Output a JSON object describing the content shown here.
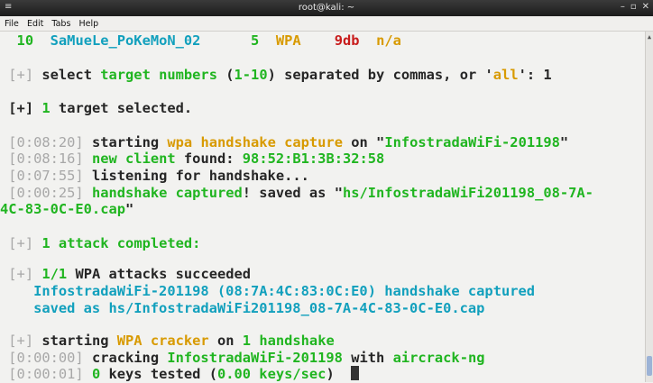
{
  "window": {
    "title": "root@kali: ~",
    "menu_glyph": "≡",
    "controls": [
      "–",
      "▫",
      "✕"
    ]
  },
  "menubar": {
    "items": [
      "File",
      "Edit",
      "Tabs",
      "Help"
    ]
  },
  "terminal": {
    "row10": {
      "num": "10",
      "essid": "SaMueLe_PoKeMoN_02",
      "channel": "5",
      "enc": "WPA",
      "power": "9db",
      "wps": "n/a"
    },
    "select": {
      "tag": "[+]",
      "p1": " select ",
      "p2": "target numbers",
      "p3": " (",
      "p4": "1-10",
      "p5": ") separated by commas, or '",
      "p6": "all",
      "p7": "': 1"
    },
    "selected": {
      "tag": "[+]",
      "num": "1",
      "text": " target selected."
    },
    "capture": [
      {
        "time": "[0:08:20]",
        "a": "starting ",
        "b": "wpa handshake capture",
        "c": " on \"",
        "d": "InfostradaWiFi-201198",
        "e": "\""
      },
      {
        "time": "[0:08:16]",
        "a": "new client",
        "b": " found: ",
        "c": "98:52:B1:3B:32:58"
      },
      {
        "time": "[0:07:55]",
        "a": "listening for handshake..."
      },
      {
        "time": "[0:00:25]",
        "a": "handshake captured",
        "b": "! saved as \"",
        "c": "hs/InfostradaWiFi201198_08-7A-",
        "d": "4C-83-0C-E0.cap",
        "e": "\""
      }
    ],
    "attack": {
      "tag": "[+]",
      "num": "1",
      "text": " attack completed:"
    },
    "result": {
      "tag": "[+]",
      "ratio": "1/1",
      "text": " WPA attacks succeeded",
      "l2": "    InfostradaWiFi-201198 (08:7A:4C:83:0C:E0) handshake captured",
      "l3": "    saved as hs/InfostradaWiFi201198_08-7A-4C-83-0C-E0.cap"
    },
    "cracker": {
      "tag": "[+]",
      "a": " starting ",
      "b": "WPA cracker",
      "c": " on ",
      "d": "1",
      "e": " handshake"
    },
    "crack_lines": [
      {
        "time": "[0:00:00]",
        "a": " cracking ",
        "b": "InfostradaWiFi-201198",
        "c": " with ",
        "d": "aircrack-ng"
      },
      {
        "time": "[0:00:01]",
        "a": " 0",
        "b": " keys tested (",
        "c": "0.00 keys/sec",
        "d": ")"
      }
    ]
  },
  "colors": {
    "background": "#f2f2f0",
    "green": "#20b520",
    "yellow": "#d89a00",
    "red": "#c81c1c",
    "cyan": "#12a0bd",
    "dim": "#a8a8a8"
  }
}
